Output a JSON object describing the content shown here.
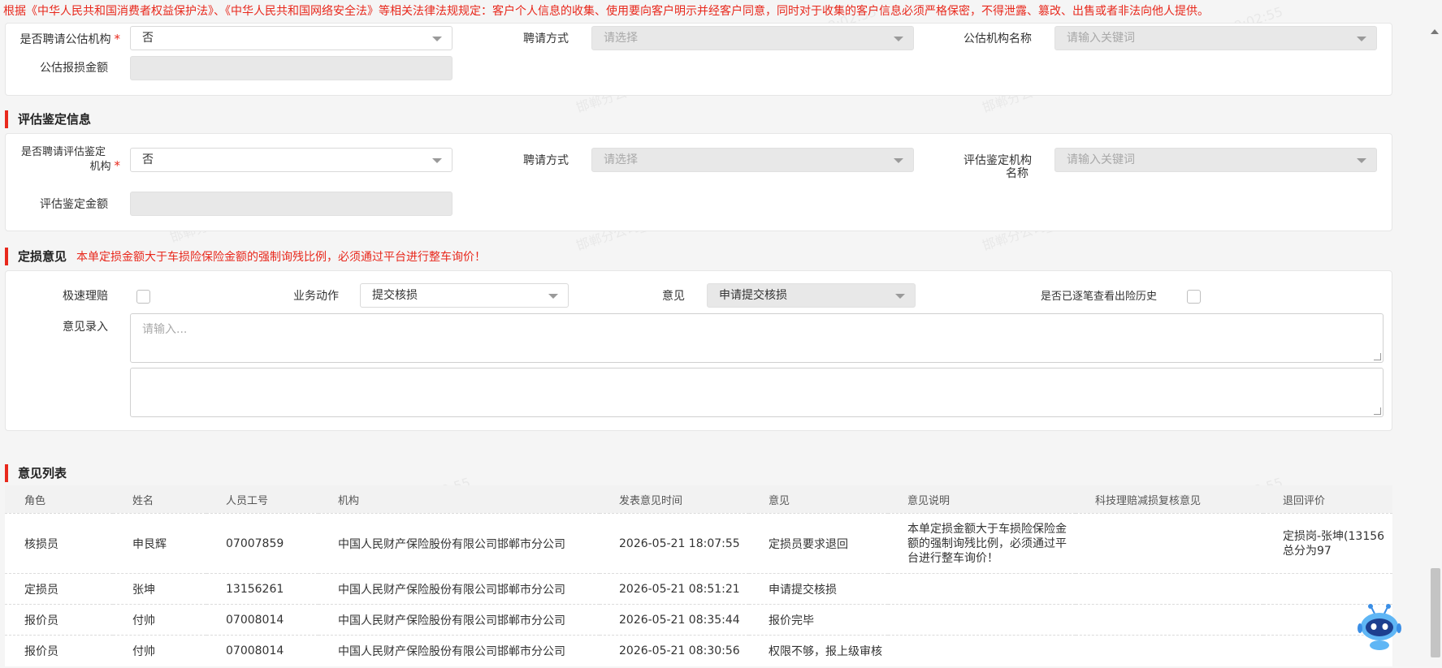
{
  "notice": "根据《中华人民共和国消费者权益保护法》、《中华人民共和国网络安全法》等相关法律法规规定：客户个人信息的收集、使用要向客户明示并经客户同意，同时对于收集的客户信息必须严格保密，不得泄露、篡改、出售或者非法向他人提供。",
  "watermark": "邯郸分公司_13156261_张坤_2026-05-21 19:02:55",
  "public_assess": {
    "hire_label": "是否聘请公估机构",
    "hire_value": "否",
    "method_label": "聘请方式",
    "method_placeholder": "请选择",
    "org_label": "公估机构名称",
    "org_placeholder": "请输入关键词",
    "amount_label": "公估报损金额"
  },
  "appraisal": {
    "title": "评估鉴定信息",
    "hire_label_line1": "是否聘请评估鉴定",
    "hire_label_line2": "机构",
    "hire_value": "否",
    "method_label": "聘请方式",
    "method_placeholder": "请选择",
    "org_label_line1": "评估鉴定机构",
    "org_label_line2": "名称",
    "org_placeholder": "请输入关键词",
    "amount_label": "评估鉴定金额"
  },
  "opinion": {
    "title": "定损意见",
    "warning": "本单定损金额大于车损险保险金额的强制询残比例，必须通过平台进行整车询价！",
    "fast_claim_label": "极速理赔",
    "action_label": "业务动作",
    "action_value": "提交核损",
    "opinion_label": "意见",
    "opinion_value": "申请提交核损",
    "history_label": "是否已逐笔查看出险历史",
    "entry_label": "意见录入",
    "entry_placeholder": "请输入..."
  },
  "opinion_list": {
    "title": "意见列表",
    "columns": [
      "角色",
      "姓名",
      "人员工号",
      "机构",
      "发表意见时间",
      "意见",
      "意见说明",
      "科技理赔减损复核意见",
      "退回评价"
    ],
    "rows": [
      [
        "核损员",
        "申艮辉",
        "07007859",
        "中国人民财产保险股份有限公司邯郸市分公司",
        "2026-05-21 18:07:55",
        "定损员要求退回",
        "本单定损金额大于车损险保险金额的强制询残比例，必须通过平台进行整车询价！",
        "",
        "定损岗-张坤(13156总分为97"
      ],
      [
        "定损员",
        "张坤",
        "13156261",
        "中国人民财产保险股份有限公司邯郸市分公司",
        "2026-05-21 08:51:21",
        "申请提交核损",
        "",
        "",
        ""
      ],
      [
        "报价员",
        "付帅",
        "07008014",
        "中国人民财产保险股份有限公司邯郸市分公司",
        "2026-05-21 08:35:44",
        "报价完毕",
        "",
        "",
        ""
      ],
      [
        "报价员",
        "付帅",
        "07008014",
        "中国人民财产保险股份有限公司邯郸市分公司",
        "2026-05-21 08:30:56",
        "权限不够，报上级审核",
        "",
        "",
        ""
      ]
    ]
  }
}
